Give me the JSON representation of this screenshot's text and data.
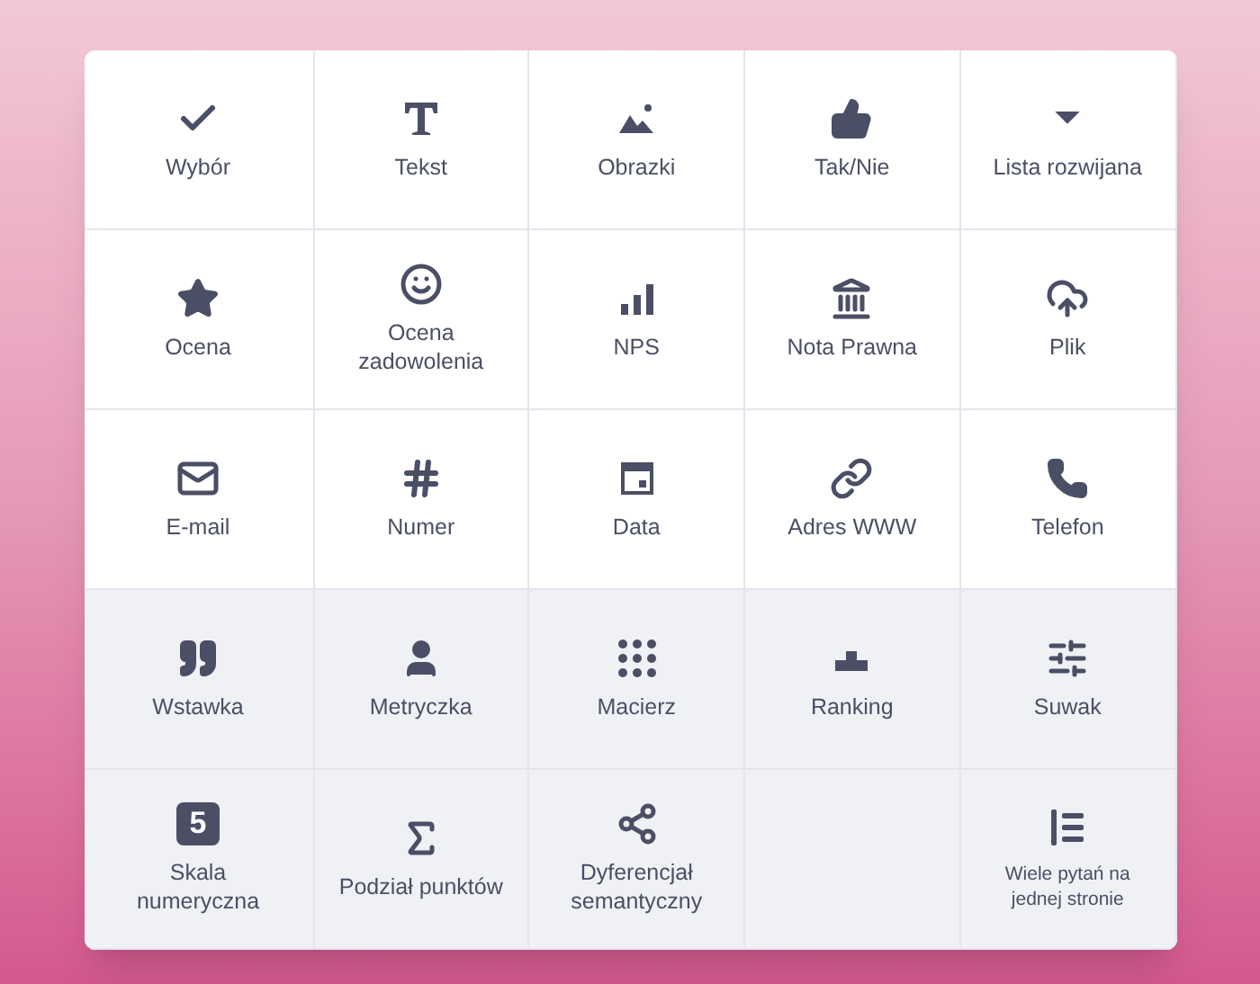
{
  "groups": [
    {
      "shaded": false,
      "items": [
        {
          "kind": "check",
          "label": "Wybór"
        },
        {
          "kind": "text",
          "label": "Tekst"
        },
        {
          "kind": "image",
          "label": "Obrazki"
        },
        {
          "kind": "thumb",
          "label": "Tak/Nie"
        },
        {
          "kind": "dropdown",
          "label": "Lista rozwijana"
        },
        {
          "kind": "star",
          "label": "Ocena"
        },
        {
          "kind": "smile",
          "label": "Ocena zadowolenia"
        },
        {
          "kind": "bars",
          "label": "NPS"
        },
        {
          "kind": "bank",
          "label": "Nota Prawna"
        },
        {
          "kind": "upload",
          "label": "Plik"
        },
        {
          "kind": "mail",
          "label": "E-mail"
        },
        {
          "kind": "hash",
          "label": "Numer"
        },
        {
          "kind": "calendar",
          "label": "Data"
        },
        {
          "kind": "link",
          "label": "Adres WWW"
        },
        {
          "kind": "phone",
          "label": "Telefon"
        }
      ]
    },
    {
      "shaded": true,
      "items": [
        {
          "kind": "quote",
          "label": "Wstawka"
        },
        {
          "kind": "person",
          "label": "Metryczka"
        },
        {
          "kind": "dots",
          "label": "Macierz"
        },
        {
          "kind": "podium",
          "label": "Ranking"
        },
        {
          "kind": "sliders",
          "label": "Suwak"
        },
        {
          "kind": "digit",
          "glyph": "5",
          "label": "Skala numeryczna"
        },
        {
          "kind": "sigma",
          "label": "Podział punktów"
        },
        {
          "kind": "share",
          "label": "Dyferencjał semantyczny"
        },
        {
          "kind": "empty"
        },
        {
          "kind": "list",
          "label": "Wiele pytań na jednej stronie",
          "small": true
        }
      ]
    }
  ]
}
